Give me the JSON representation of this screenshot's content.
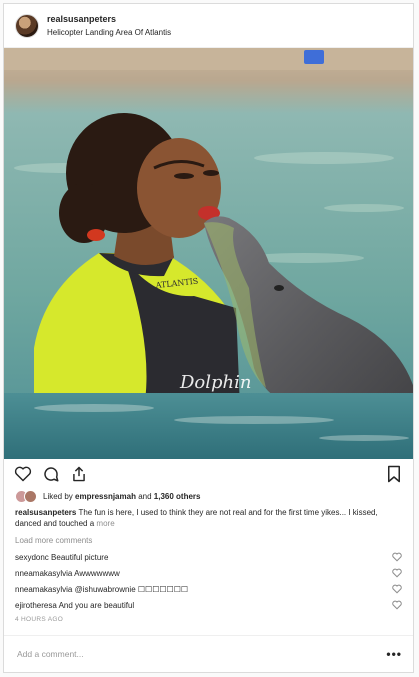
{
  "post": {
    "username": "realsusanpeters",
    "location": "Helicopter Landing Area Of Atlantis",
    "photo_alt": "Woman kissing a dolphin in a pool",
    "likes_text_prefix": "Liked by",
    "liked_by": "empressnjamah",
    "likes_and": "and",
    "likes_others": "1,360 others",
    "caption_user": "realsusanpeters",
    "caption_text": "The fun is here, I used to think they are not real and for the first time yikes... I kissed, danced and touched a",
    "caption_more": "more",
    "load_more": "Load more comments",
    "comments": [
      {
        "user": "sexydonc",
        "text": "Beautiful picture"
      },
      {
        "user": "nneamakasylvia",
        "text": "Awwwwwww"
      },
      {
        "user": "nneamakasylvia",
        "text": "@ishuwabrownie ☐☐☐☐☐☐☐"
      },
      {
        "user": "ejirotheresa",
        "text": "And you are beautiful"
      }
    ],
    "time_ago": "4 HOURS AGO",
    "add_comment_placeholder": "Add a comment...",
    "options": "•••"
  },
  "wetsuit_text": {
    "brand": "ATLANTIS",
    "logo": "Dolphin"
  },
  "icons": [
    "heart-icon",
    "comment-icon",
    "share-icon",
    "bookmark-icon",
    "small-heart-icon",
    "more-options-icon"
  ],
  "colors": {
    "accent_text": "#262626",
    "muted": "#8e8e8e",
    "wetsuit_yellow": "#d6e82c",
    "water": "#7fb0aa",
    "dolphin": "#5d5d5f"
  }
}
